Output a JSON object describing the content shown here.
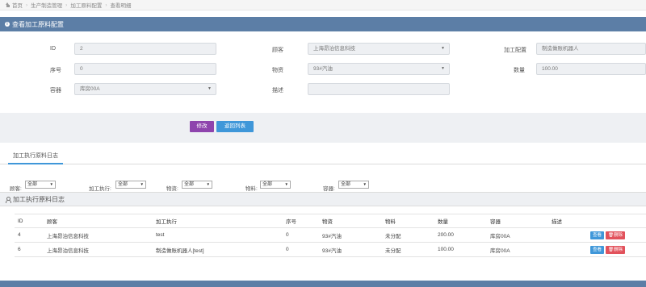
{
  "breadcrumb": [
    "首页",
    "生产制造管理",
    "加工原料配置",
    "查看明细"
  ],
  "panel": {
    "title": "查看加工原料配置"
  },
  "form": {
    "id_label": "ID",
    "id_value": "2",
    "customer_label": "顾客",
    "customer_value": "上海昂泊信息科技",
    "config_label": "加工配置",
    "config_value": "制造做账机器人",
    "seq_label": "序号",
    "seq_value": "0",
    "material_label": "物资",
    "material_value": "93#汽油",
    "qty_label": "数量",
    "qty_value": "100.00",
    "container_label": "容器",
    "container_value": "库房00A",
    "desc_label": "描述",
    "desc_value": ""
  },
  "buttons": {
    "edit": "修改",
    "back": "返回列表"
  },
  "tabs": [
    {
      "label": "加工执行原料日志",
      "active": true
    }
  ],
  "filters": [
    {
      "label": "顾客:",
      "value": "全部"
    },
    {
      "label": "加工执行:",
      "value": "全部"
    },
    {
      "label": "物资:",
      "value": "全部"
    },
    {
      "label": "物料:",
      "value": "全部"
    },
    {
      "label": "容器:",
      "value": "全部"
    }
  ],
  "logs": {
    "title": "加工执行原料日志",
    "columns": [
      "ID",
      "顾客",
      "加工执行",
      "序号",
      "物资",
      "物料",
      "数量",
      "容器",
      "描述",
      ""
    ],
    "rows": [
      {
        "id": "4",
        "customer": "上海昂泊信息科技",
        "exec": "test",
        "seq": "0",
        "material": "93#汽油",
        "item": "未分配",
        "qty": "200.00",
        "container": "库房00A",
        "desc": ""
      },
      {
        "id": "6",
        "customer": "上海昂泊信息科技",
        "exec": "制造做账机器人[test]",
        "seq": "0",
        "material": "93#汽油",
        "item": "未分配",
        "qty": "100.00",
        "container": "库房00A",
        "desc": ""
      }
    ],
    "view_label": "查看",
    "delete_label": "删除"
  },
  "colors": {
    "header": "#5c7ea6",
    "edit": "#8e44ad",
    "back": "#3f97d9",
    "delete": "#e2525c"
  }
}
